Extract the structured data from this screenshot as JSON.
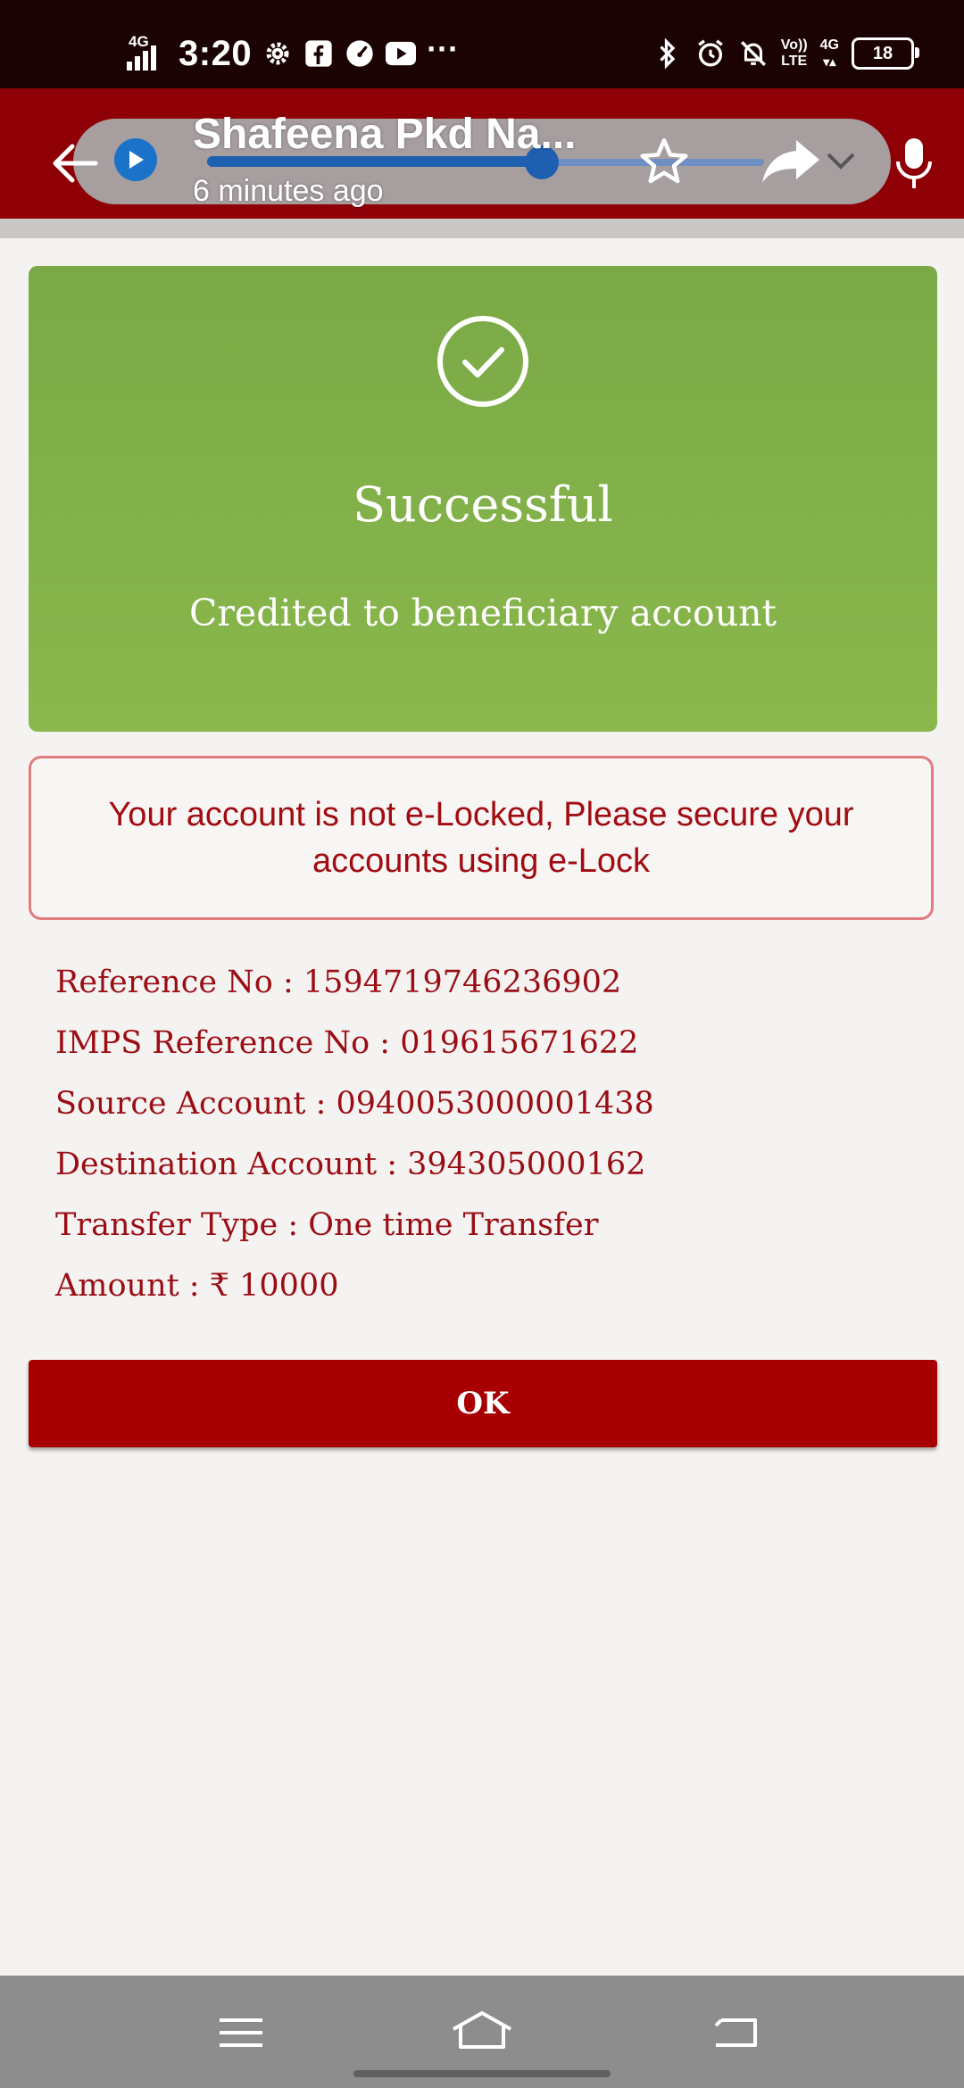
{
  "status_bar": {
    "network": "4G",
    "time": "3:20",
    "left_icons": [
      "settings-icon",
      "facebook-icon",
      "speedometer-icon",
      "youtube-icon",
      "more-dots-icon"
    ],
    "more": "···",
    "right_icons": [
      "bluetooth-icon",
      "alarm-icon",
      "bell-off-icon"
    ],
    "volte_top": "Vo))",
    "volte_bottom": "LTE",
    "network_right": "4G",
    "battery": "18"
  },
  "header": {
    "title": "Shafeena Pkd Na...",
    "subtitle": "6 minutes ago",
    "icons": [
      "back-arrow-icon",
      "play-icon",
      "star-icon",
      "forward-icon",
      "chevron-down-icon",
      "mic-icon"
    ]
  },
  "success": {
    "title": "Successful",
    "message": "Credited to beneficiary account",
    "color": "#86b34b"
  },
  "warning": {
    "text": "Your account is not e-Locked, Please secure your accounts using e-Lock",
    "color": "#a00c12"
  },
  "details": [
    "Reference No : 1594719746236902",
    "IMPS Reference No : 019615671622",
    "Source Account : 0940053000001438",
    "Destination Account : 394305000162",
    "Transfer Type : One time Transfer",
    "Amount : ₹ 10000"
  ],
  "ok_button": {
    "label": "OK",
    "color": "#a80002"
  },
  "nav_bar": {
    "icons": [
      "menu-icon",
      "home-icon",
      "back-icon"
    ]
  }
}
